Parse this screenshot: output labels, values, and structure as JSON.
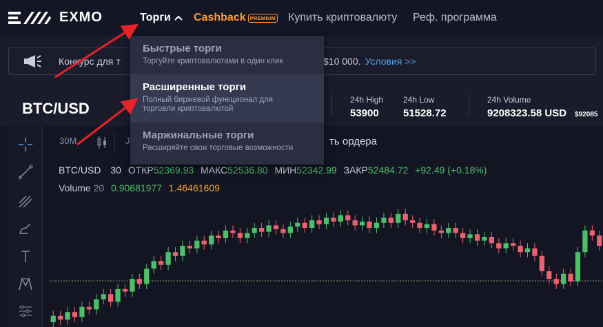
{
  "brand": {
    "name": "EXMO"
  },
  "nav": {
    "trade": "Торги",
    "cashback": "Cashback",
    "premium_badge": "PREMIUM",
    "buy_crypto": "Купить криптовалюту",
    "referral": "Реф. программа"
  },
  "announcement": {
    "text_left": "Конкурс для т",
    "text_right": "$10 000.",
    "link": "Условия >>"
  },
  "dropdown": {
    "items": [
      {
        "title": "Быстрые торги",
        "desc": "Торгуйте криптовалютами в один клик"
      },
      {
        "title": "Расширенные торги",
        "desc": "Полный биржевой функционал для торговли криптовалютой"
      },
      {
        "title": "Маржинальные торги",
        "desc": "Расширяйте свои торговые возможности"
      }
    ]
  },
  "ticker": {
    "pair": "BTC/USD",
    "stats": [
      {
        "label": "24h High",
        "value": "53900"
      },
      {
        "label": "24h Low",
        "value": "51528.72"
      },
      {
        "label": "24h Volume",
        "value": "9208323.58 USD",
        "sub": "$92085"
      }
    ]
  },
  "chart_toolbar": {
    "interval": "30M",
    "partial": "J",
    "orders": "ть ордера"
  },
  "ohlc": {
    "symbol": "BTC/USD",
    "interval": "30",
    "open_label": "ОТКР",
    "open": "52369.93",
    "high_label": "МАКС",
    "high": "52536.80",
    "low_label": "МИН",
    "low": "52342.99",
    "close_label": "ЗАКР",
    "close": "52484.72",
    "change": "+92.49 (+0.18%)"
  },
  "volume": {
    "label": "Volume",
    "period": "20",
    "v1": "0.90681977",
    "v2": "1.46461609"
  },
  "colors": {
    "up": "#4ebe6a",
    "down": "#e9636e",
    "accent": "#4aa3f0",
    "cashback": "#ff9b2f",
    "arrow": "#e8222a"
  },
  "chart_data": {
    "type": "candlestick",
    "series": [
      {
        "values": [
          [
            0.0,
            0.05
          ],
          [
            0.05,
            0.02
          ],
          [
            0.02,
            0.08
          ],
          [
            0.08,
            0.04
          ],
          [
            0.04,
            0.12
          ],
          [
            0.12,
            0.1
          ],
          [
            0.1,
            0.18
          ],
          [
            0.18,
            0.22
          ],
          [
            0.22,
            0.16
          ],
          [
            0.16,
            0.26
          ],
          [
            0.26,
            0.24
          ],
          [
            0.24,
            0.34
          ],
          [
            0.34,
            0.3
          ],
          [
            0.3,
            0.42
          ],
          [
            0.42,
            0.48
          ],
          [
            0.48,
            0.45
          ],
          [
            0.45,
            0.55
          ],
          [
            0.55,
            0.52
          ],
          [
            0.52,
            0.6
          ],
          [
            0.6,
            0.58
          ],
          [
            0.58,
            0.64
          ],
          [
            0.64,
            0.61
          ],
          [
            0.61,
            0.68
          ],
          [
            0.68,
            0.66
          ],
          [
            0.66,
            0.72
          ],
          [
            0.72,
            0.7
          ],
          [
            0.7,
            0.66
          ],
          [
            0.66,
            0.7
          ],
          [
            0.7,
            0.74
          ],
          [
            0.74,
            0.71
          ],
          [
            0.71,
            0.76
          ],
          [
            0.76,
            0.73
          ],
          [
            0.73,
            0.7
          ],
          [
            0.7,
            0.75
          ],
          [
            0.75,
            0.78
          ],
          [
            0.78,
            0.74
          ],
          [
            0.74,
            0.8
          ],
          [
            0.8,
            0.77
          ],
          [
            0.77,
            0.82
          ],
          [
            0.82,
            0.79
          ],
          [
            0.79,
            0.84
          ],
          [
            0.84,
            0.8
          ],
          [
            0.8,
            0.76
          ],
          [
            0.76,
            0.79
          ],
          [
            0.79,
            0.74
          ],
          [
            0.74,
            0.78
          ],
          [
            0.78,
            0.82
          ],
          [
            0.82,
            0.78
          ],
          [
            0.78,
            0.85
          ],
          [
            0.85,
            0.8
          ],
          [
            0.8,
            0.78
          ],
          [
            0.78,
            0.74
          ],
          [
            0.74,
            0.77
          ],
          [
            0.77,
            0.72
          ],
          [
            0.72,
            0.7
          ],
          [
            0.7,
            0.74
          ],
          [
            0.74,
            0.7
          ],
          [
            0.7,
            0.66
          ],
          [
            0.66,
            0.69
          ],
          [
            0.69,
            0.64
          ],
          [
            0.64,
            0.67
          ],
          [
            0.67,
            0.62
          ],
          [
            0.62,
            0.58
          ],
          [
            0.58,
            0.62
          ],
          [
            0.62,
            0.6
          ],
          [
            0.6,
            0.55
          ],
          [
            0.55,
            0.58
          ],
          [
            0.58,
            0.52
          ],
          [
            0.52,
            0.4
          ],
          [
            0.4,
            0.34
          ],
          [
            0.34,
            0.3
          ],
          [
            0.3,
            0.38
          ],
          [
            0.38,
            0.32
          ],
          [
            0.32,
            0.55
          ],
          [
            0.55,
            0.72
          ],
          [
            0.72,
            0.68
          ],
          [
            0.68,
            0.6
          ]
        ]
      }
    ]
  }
}
